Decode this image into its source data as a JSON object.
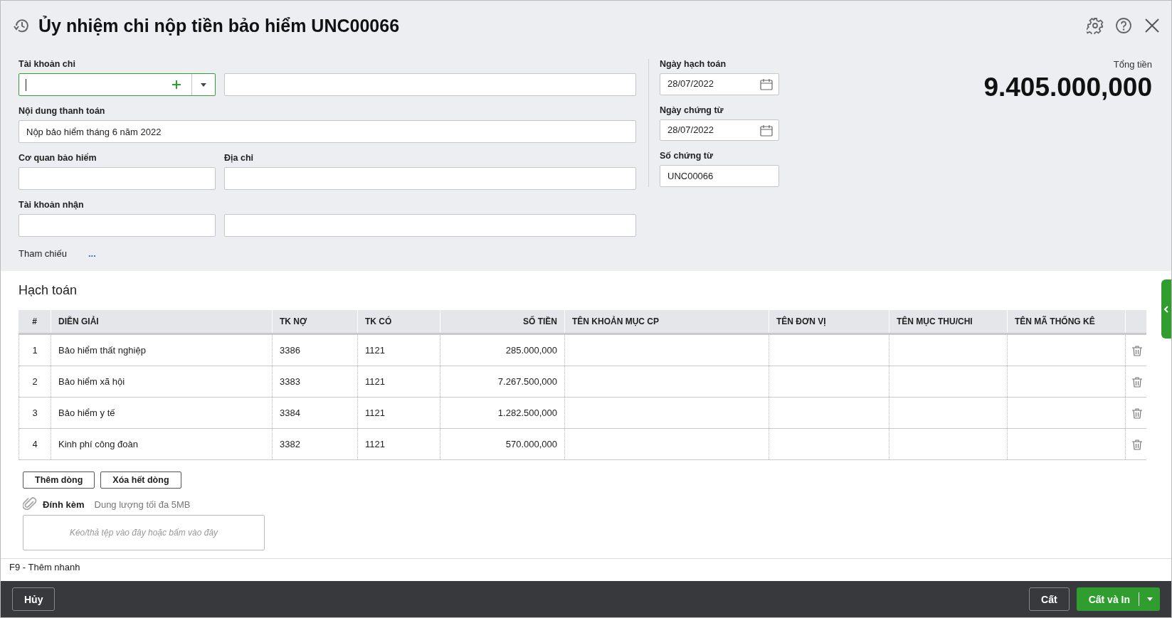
{
  "window": {
    "title": "Ủy nhiệm chi nộp tiền bảo hiểm UNC00066"
  },
  "payment_account": {
    "label": "Tài khoản chi",
    "focused": true
  },
  "payment_content": {
    "label": "Nội dung thanh toán",
    "value": "Nộp bảo hiểm tháng 6 năm 2022"
  },
  "insurance_agency": {
    "label": "Cơ quan bảo hiểm"
  },
  "address": {
    "label": "Địa chỉ"
  },
  "receiving_account": {
    "label": "Tài khoản nhận"
  },
  "reference": {
    "label": "Tham chiếu",
    "link": "..."
  },
  "posting_date": {
    "label": "Ngày hạch toán",
    "value": "28/07/2022"
  },
  "document_date": {
    "label": "Ngày chứng từ",
    "value": "28/07/2022"
  },
  "document_number": {
    "label": "Số chứng từ",
    "value": "UNC00066"
  },
  "total": {
    "label": "Tổng tiền",
    "value": "9.405.000,000"
  },
  "accounting": {
    "title": "Hạch toán",
    "columns": [
      "#",
      "DIỄN GIẢI",
      "TK NỢ",
      "TK CÓ",
      "SỐ TIỀN",
      "TÊN KHOẢN MỤC CP",
      "TÊN ĐƠN VỊ",
      "TÊN MỤC THU/CHI",
      "TÊN MÃ THỐNG KÊ"
    ],
    "rows": [
      [
        "1",
        "Bảo hiểm thất nghiệp",
        "3386",
        "1121",
        "285.000,000"
      ],
      [
        "2",
        "Bảo hiểm xã hội",
        "3383",
        "1121",
        "7.267.500,000"
      ],
      [
        "3",
        "Bảo hiểm y tế",
        "3384",
        "1121",
        "1.282.500,000"
      ],
      [
        "4",
        "Kinh phí công đoàn",
        "3382",
        "1121",
        "570.000,000"
      ]
    ]
  },
  "row_buttons": [
    "Thêm dòng",
    "Xóa hết dòng"
  ],
  "attachment": {
    "label": "Đính kèm",
    "hint": "Dung lượng tối đa 5MB",
    "dropzone": "Kéo/thả tệp vào đây hoặc bấm vào đây"
  },
  "shortcut_hint": "F9 - Thêm nhanh",
  "footer": {
    "cancel": "Hủy",
    "save": "Cất",
    "save_print": "Cất và In"
  }
}
